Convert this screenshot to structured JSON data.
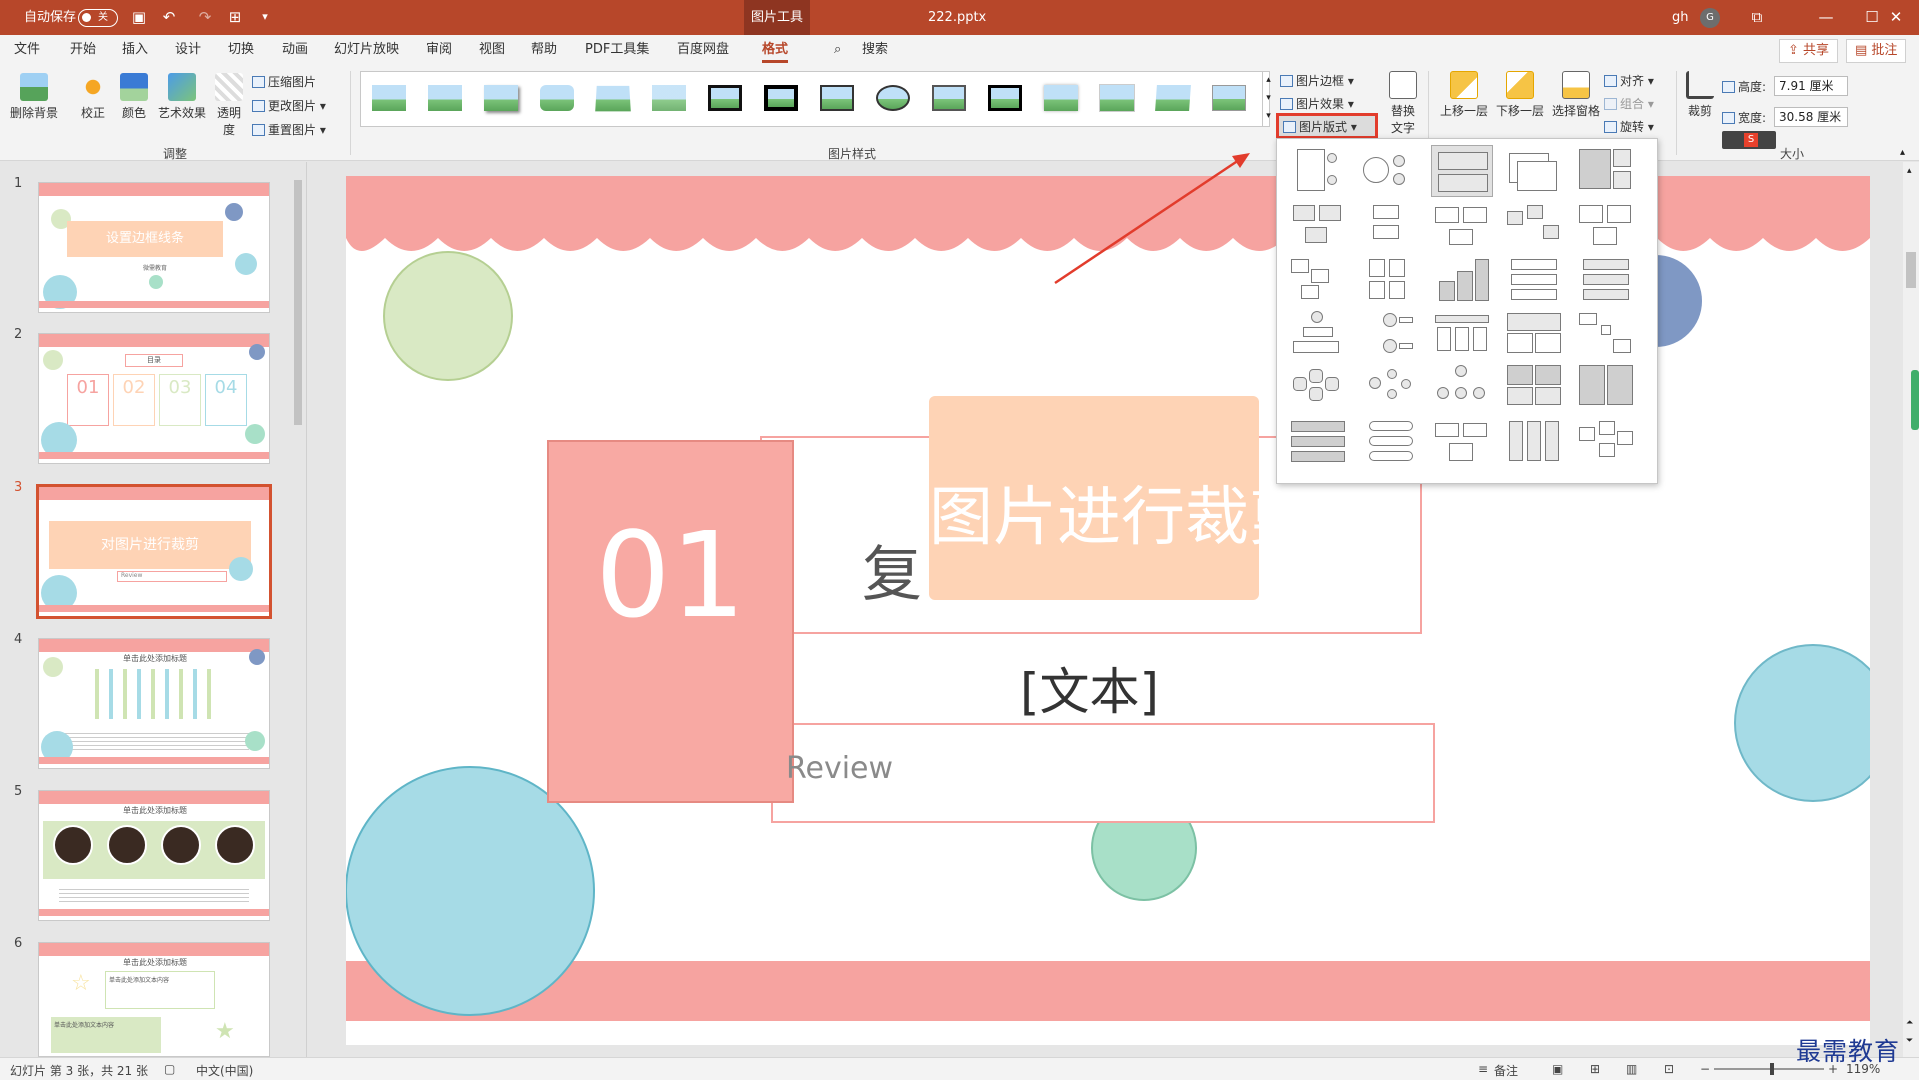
{
  "titlebar": {
    "autosave_label": "自动保存",
    "autosave_state": "关",
    "context_tab": "图片工具",
    "filename": "222.pptx",
    "user": "gh",
    "user_initial": "G"
  },
  "tabs": [
    "文件",
    "开始",
    "插入",
    "设计",
    "切换",
    "动画",
    "幻灯片放映",
    "审阅",
    "视图",
    "帮助",
    "PDF工具集",
    "百度网盘",
    "格式"
  ],
  "active_tab": "格式",
  "search_label": "搜索",
  "share_label": "共享",
  "comment_label": "批注",
  "ribbon": {
    "remove_bg": "删除背景",
    "correct": "校正",
    "color": "颜色",
    "art_effects": "艺术效果",
    "transparency": "透明度",
    "compress": "压缩图片",
    "change_pic": "更改图片",
    "reset_pic": "重置图片",
    "group_adjust": "调整",
    "group_styles": "图片样式",
    "border": "图片边框",
    "effects": "图片效果",
    "layout": "图片版式",
    "alt_text_1": "替换",
    "alt_text_2": "文字",
    "bring_forward": "上移一层",
    "send_backward": "下移一层",
    "selection_pane": "选择窗格",
    "align": "对齐",
    "group": "组合",
    "rotate": "旋转",
    "crop": "裁剪",
    "height_label": "高度:",
    "height_value": "7.91 厘米",
    "width_label": "宽度:",
    "width_value": "30.58 厘米",
    "group_size": "大小"
  },
  "slides": [
    {
      "num": "1",
      "title": "设置边框线条",
      "sub": "微需教育"
    },
    {
      "num": "2",
      "title": "目录",
      "items": [
        "01",
        "02",
        "03",
        "04"
      ]
    },
    {
      "num": "3",
      "title": "对图片进行裁剪",
      "sub": "Review"
    },
    {
      "num": "4",
      "title": "单击此处添加标题"
    },
    {
      "num": "5",
      "title": "单击此处添加标题"
    },
    {
      "num": "6",
      "title": "单击此处添加标题",
      "sub": "单击此处添加文本内容"
    }
  ],
  "canvas": {
    "number": "01",
    "overlay_text": "图片进行裁剪",
    "partial_char": "复",
    "placeholder": "[文本]",
    "review": "Review"
  },
  "status": {
    "slide_info": "幻灯片 第 3 张，共 21 张",
    "language": "中文(中国)",
    "notes": "备注",
    "zoom": "119%"
  },
  "watermark": "最需教育"
}
